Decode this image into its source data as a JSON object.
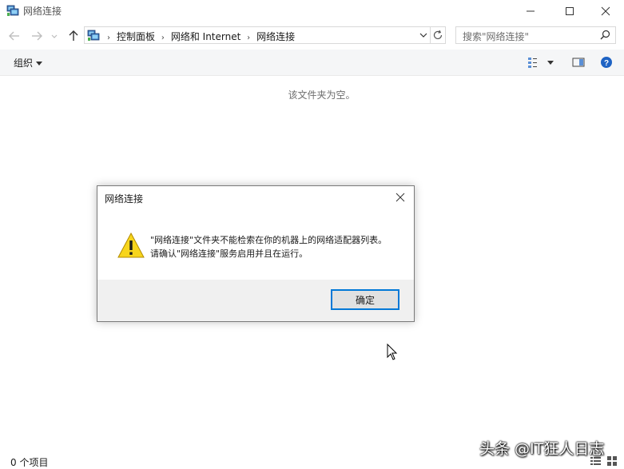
{
  "window": {
    "title": "网络连接"
  },
  "address": {
    "crumbs": [
      "控制面板",
      "网络和 Internet",
      "网络连接"
    ]
  },
  "search": {
    "placeholder": "搜索\"网络连接\""
  },
  "toolbar": {
    "organize_label": "组织"
  },
  "content": {
    "empty_message": "该文件夹为空。"
  },
  "dialog": {
    "title": "网络连接",
    "message_line1": "\"网络连接\"文件夹不能检索在你的机器上的网络适配器列表。",
    "message_line2": "请确认\"网络连接\"服务启用并且在运行。",
    "ok_label": "确定"
  },
  "status": {
    "item_count": "0 个项目"
  },
  "watermark": {
    "text": "头条 @IT狂人日志"
  },
  "colors": {
    "accent": "#0078d7",
    "warning": "#f7d51d",
    "cmdbar_bg": "#f5f6f7",
    "dialog_footer_bg": "#f0f0f0"
  },
  "icons": {
    "title": "network-connections-icon",
    "back": "arrow-left-icon",
    "forward": "arrow-right-icon",
    "recent": "chevron-down-icon",
    "up": "arrow-up-icon",
    "refresh": "refresh-icon",
    "search": "search-icon",
    "warning": "warning-icon"
  }
}
